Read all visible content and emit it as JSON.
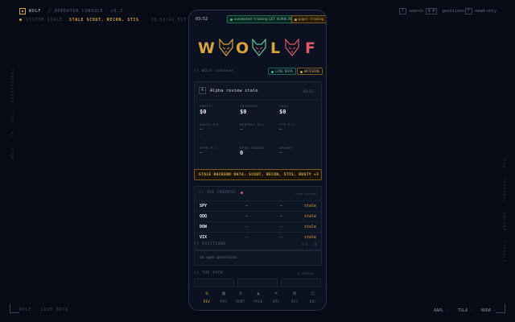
{
  "topbar": {
    "brand": "WOLF",
    "console": "/ OPERATOR CONSOLE",
    "version": "· v0.3",
    "status_label": "SYSTEM STALE",
    "status_message": "STALE SCOUT, RECON, STIS",
    "clock": "03:53:41 EST",
    "shortcuts": [
      {
        "key": "/",
        "label": "search"
      },
      {
        "key": "g p",
        "label": "positions"
      },
      {
        "key": "r",
        "label": "read-only"
      }
    ]
  },
  "side": {
    "left": "WOLF · CH · 001 · OPERATIONAL",
    "right": "RAW · TERMINAL · ONLINE · SIGNALS"
  },
  "footer": {
    "label": "WOLF · LIVE DATA",
    "tickers": [
      {
        "symbol": "AAPL",
        "value": "—"
      },
      {
        "symbol": "TSLA",
        "value": "—"
      },
      {
        "symbol": "NVDA",
        "value": "—"
      }
    ]
  },
  "phone": {
    "time": "03:52",
    "pill_automation": "automated-trading:LET ALPHA RUN",
    "pill_paper": "paper trading",
    "logo_letters": [
      "W",
      "O",
      "L",
      "F"
    ],
    "section_label": "// WOLF unknown",
    "badge_live": "LIVE DATA",
    "badge_watching": "WATCHING",
    "card": {
      "title": "Alpha review stale",
      "time": "03:52",
      "stats": [
        {
          "label": "EQUITY",
          "value": "$0"
        },
        {
          "label": "INVESTED",
          "value": "$0"
        },
        {
          "label": "CASH",
          "value": "$0"
        }
      ],
      "pl": [
        {
          "label": "DAILY P/L",
          "value": "—",
          "sub": "—"
        },
        {
          "label": "MONTHLY P/L",
          "value": "—",
          "sub": "—"
        },
        {
          "label": "YTD P/L",
          "value": "—",
          "sub": "—"
        }
      ],
      "extra": [
        {
          "label": "OPEN P/L",
          "value": "—",
          "sub": "—"
        },
        {
          "label": "OPEN TRADES",
          "value": "0"
        },
        {
          "label": "SHARPE",
          "value": "—"
        }
      ]
    },
    "alert": "STALE BACKEND DATA: SCOUT, RECON, STIS, RUSTY +3",
    "premise": {
      "title": "// THE PREMISE",
      "right": "risk optimal",
      "rows": [
        {
          "symbol": "SPY",
          "v1": "—",
          "v2": "—",
          "status": "stale"
        },
        {
          "symbol": "QQQ",
          "v1": "—",
          "v2": "—",
          "status": "stale"
        },
        {
          "symbol": "DOW",
          "v1": "—",
          "v2": "—",
          "status": "stale"
        },
        {
          "symbol": "VIX",
          "v1": "—",
          "v2": "—",
          "status": "stale"
        }
      ]
    },
    "positions": {
      "title": "// POSITIONS",
      "right": "0/0 · $0",
      "empty": "no open positions"
    },
    "pack": {
      "title": "// THE PACK",
      "right": "4 wolves"
    },
    "nav": [
      {
        "icon": "◇",
        "label": "REV",
        "name": "nav-rev",
        "active": true
      },
      {
        "icon": "▦",
        "label": "POS",
        "name": "nav-pos"
      },
      {
        "icon": "◎",
        "label": "HUNT",
        "name": "nav-hunt"
      },
      {
        "icon": "▲",
        "label": "PACK",
        "name": "nav-pack"
      },
      {
        "icon": "⌗",
        "label": "OPS",
        "name": "nav-ops"
      },
      {
        "icon": "▤",
        "label": "HIS",
        "name": "nav-his"
      },
      {
        "icon": "□",
        "label": "DOC",
        "name": "nav-doc"
      }
    ]
  },
  "colors": {
    "accent": "#d9a43a",
    "wolf_red": "#e05a6a",
    "wolf_green": "#5fc49a",
    "background": "#070b16"
  }
}
